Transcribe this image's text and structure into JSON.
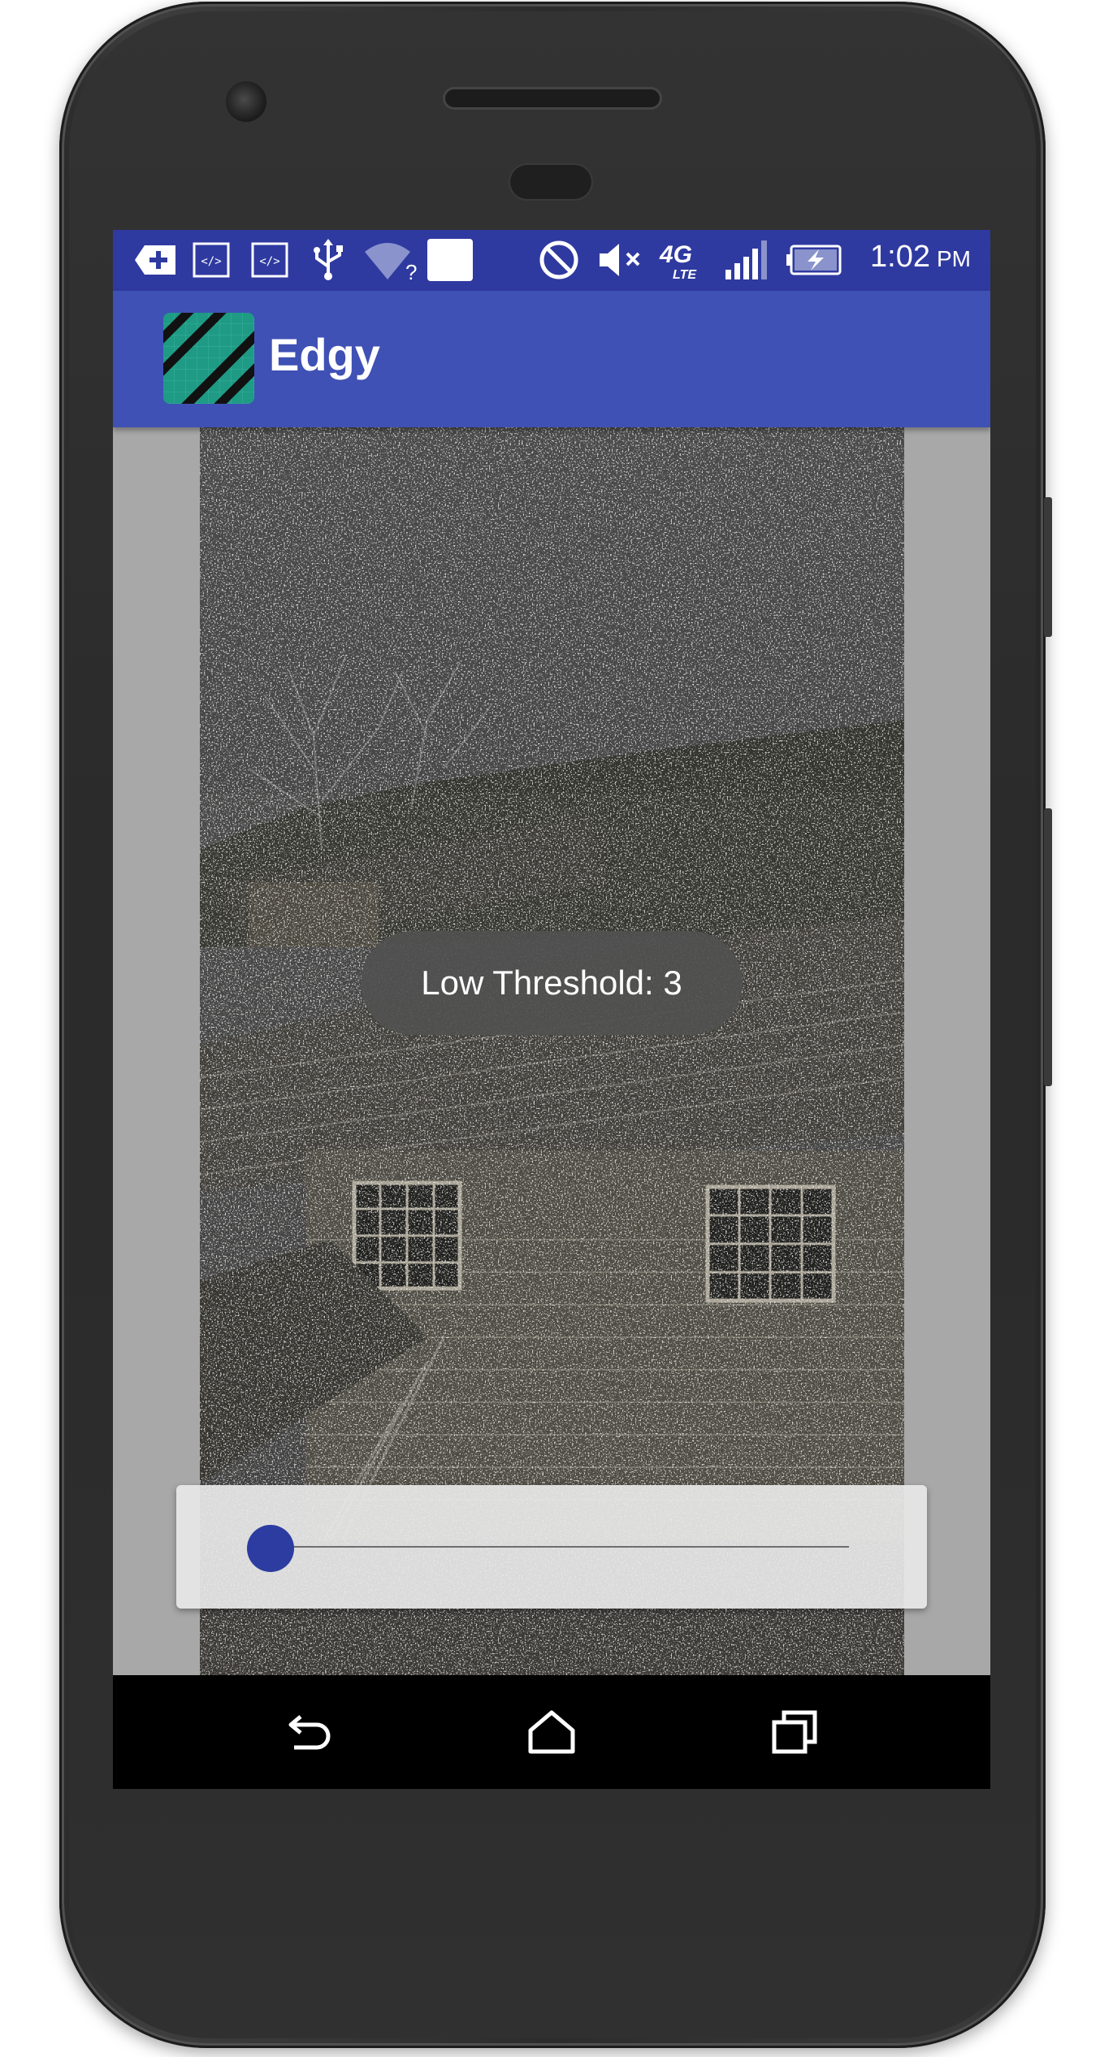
{
  "app": {
    "title": "Edgy"
  },
  "status_bar": {
    "time": "1:02",
    "ampm": "PM",
    "network_label": "4G LTE",
    "icons": [
      "plus-notification-icon",
      "code-icon",
      "code-icon",
      "usb-icon",
      "wifi-unknown-icon",
      "blank-notification-icon",
      "do-not-disturb-icon",
      "mute-icon",
      "network-4g-lte-icon",
      "signal-icon",
      "battery-charging-icon"
    ]
  },
  "toast": {
    "text": "Low Threshold: 3"
  },
  "slider": {
    "value_fraction": 0.0
  },
  "nav": {
    "back_icon": "back-icon",
    "home_icon": "home-icon",
    "recents_icon": "recents-icon"
  },
  "colors": {
    "status_bar": "#2f3aa0",
    "app_bar": "#3f51b5",
    "accent": "#2d3ca0",
    "logo_bg": "#1e9a85",
    "content_bg": "#a8a8a8"
  }
}
